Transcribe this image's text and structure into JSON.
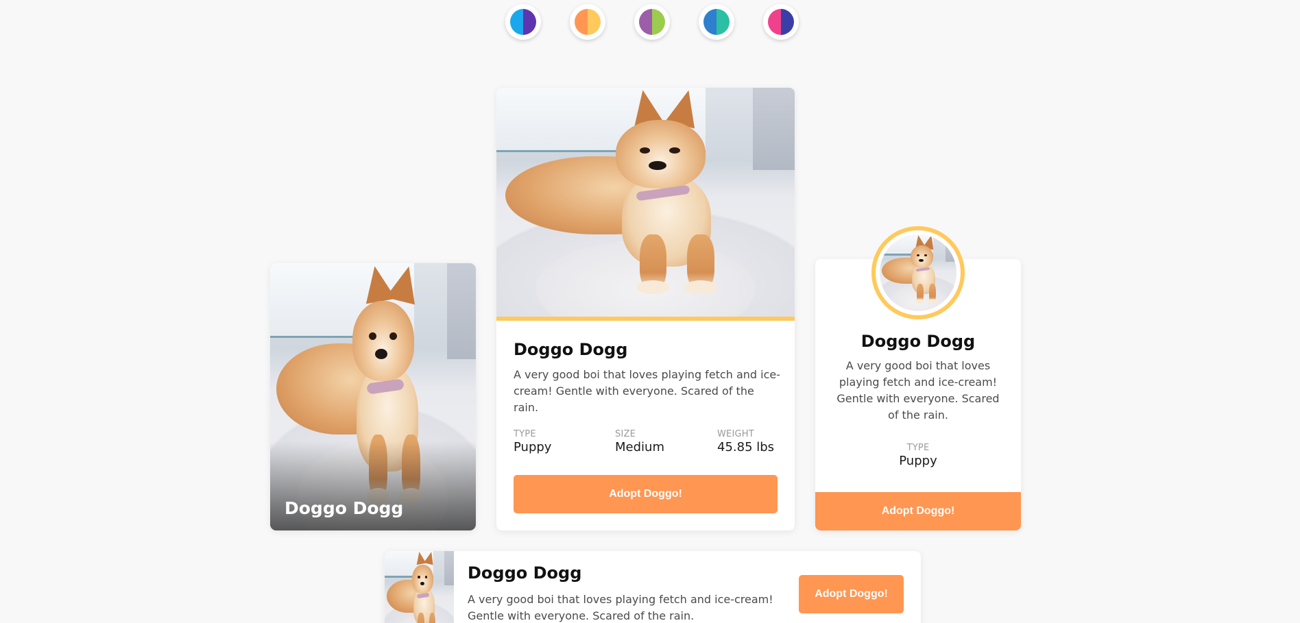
{
  "swatches": [
    {
      "name": "blue-purple",
      "left": "#1aa7ec",
      "right": "#5e35b1"
    },
    {
      "name": "orange-yellow",
      "left": "#ff9652",
      "right": "#ffc95c"
    },
    {
      "name": "purple-green",
      "left": "#9c5ea8",
      "right": "#9ccc4d"
    },
    {
      "name": "blue-teal",
      "left": "#2f7fcf",
      "right": "#2bbfa3"
    },
    {
      "name": "pink-indigo",
      "left": "#f0418d",
      "right": "#3a3fa8"
    }
  ],
  "accent_colors": {
    "button": "#ff9652",
    "ring": "#ffc95c"
  },
  "card_image": {
    "title": "Doggo Dogg",
    "photo_icon": "dog-photo"
  },
  "card_featured": {
    "title": "Doggo Dogg",
    "description": "A very good boi that loves playing fetch and ice-cream! Gentle with everyone. Scared of the rain.",
    "stats": [
      {
        "label": "TYPE",
        "value": "Puppy"
      },
      {
        "label": "SIZE",
        "value": "Medium"
      },
      {
        "label": "WEIGHT",
        "value": "45.85 lbs"
      }
    ],
    "button": "Adopt Doggo!"
  },
  "card_profile": {
    "title": "Doggo Dogg",
    "description": "A very good boi that loves playing fetch and ice-cream! Gentle with everyone. Scared of the rain.",
    "stat": {
      "label": "TYPE",
      "value": "Puppy"
    },
    "button": "Adopt Doggo!"
  },
  "card_horizontal": {
    "title": "Doggo Dogg",
    "description": "A very good boi that loves playing fetch and ice-cream! Gentle with everyone. Scared of the rain.",
    "button": "Adopt Doggo!"
  }
}
